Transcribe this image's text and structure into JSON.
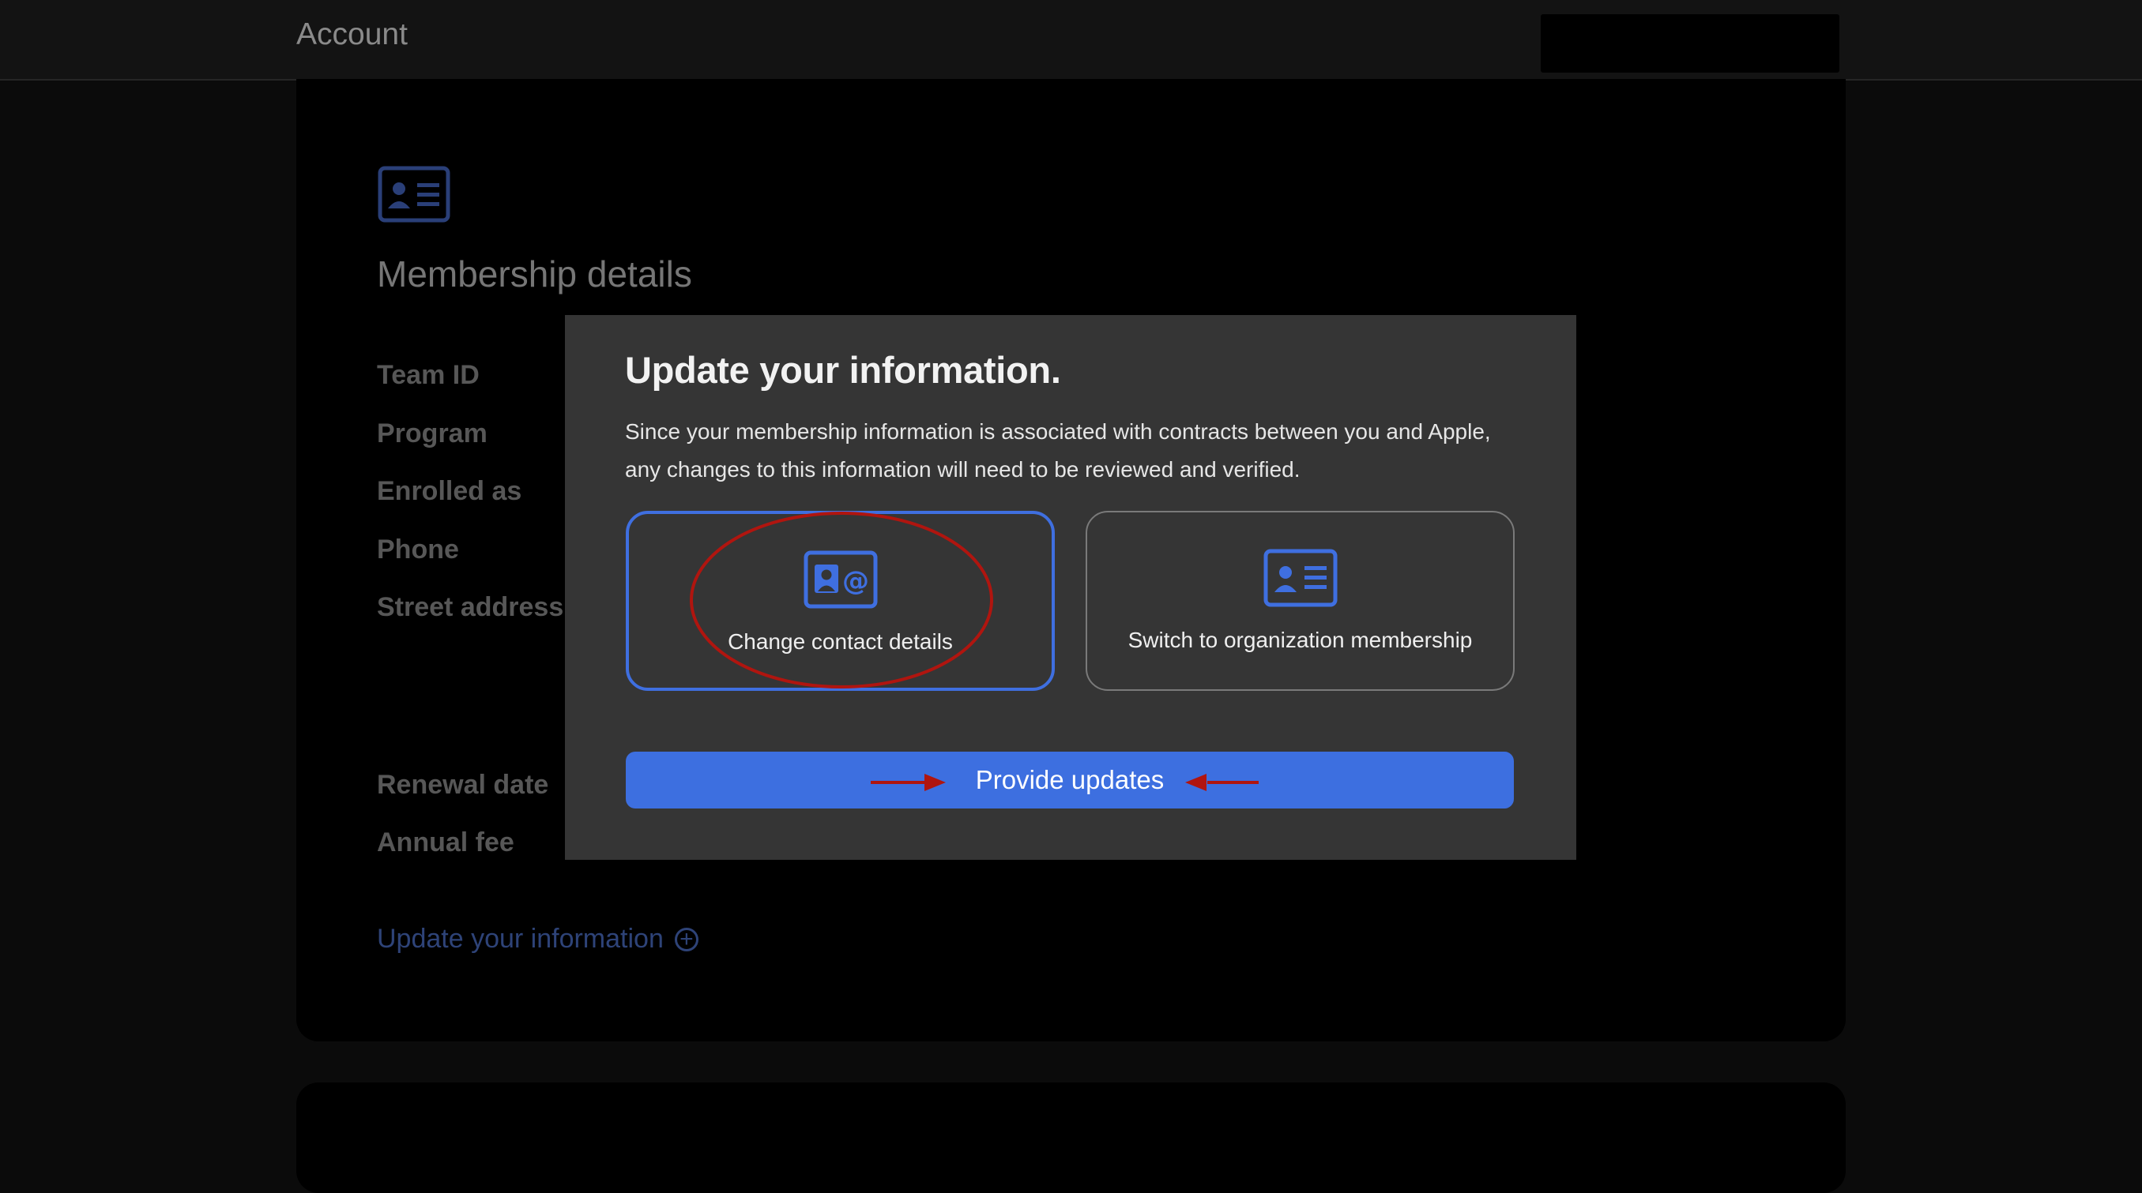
{
  "header": {
    "title": "Account"
  },
  "membership": {
    "icon": "membership-card-icon",
    "title": "Membership details",
    "fields": [
      "Team ID",
      "Program",
      "Enrolled as",
      "Phone",
      "Street address",
      "Renewal date",
      "Annual fee"
    ],
    "update_link": "Update your information",
    "update_link_icon": "plus-circle-icon"
  },
  "modal": {
    "title": "Update your information.",
    "description_line1": "Since your membership information is associated with contracts between you and Apple,",
    "description_line2": "any changes to this information will need to be reviewed and verified.",
    "options": [
      {
        "label": "Change contact details",
        "icon": "contact-card-at-icon",
        "selected": true
      },
      {
        "label": "Switch to organization membership",
        "icon": "membership-card-icon",
        "selected": false
      }
    ],
    "primary_button": "Provide updates"
  },
  "colors": {
    "accent": "#3d6fe0",
    "annotation": "#b0150f",
    "modal_bg": "#353535"
  }
}
